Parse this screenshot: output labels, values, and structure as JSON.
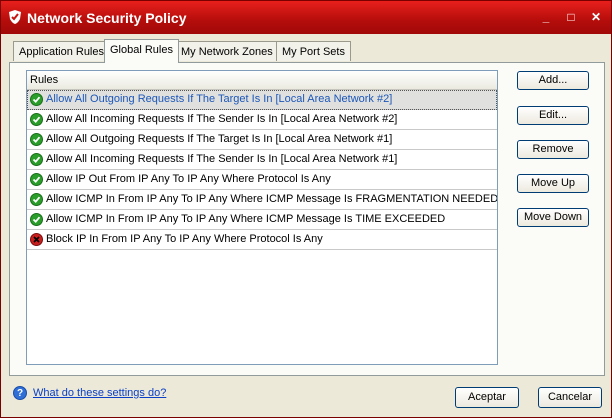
{
  "window": {
    "title": "Network Security Policy",
    "minimize_label": "_",
    "maximize_label": "□",
    "close_label": "✕"
  },
  "tabs": [
    {
      "label": "Application Rules"
    },
    {
      "label": "Global Rules"
    },
    {
      "label": "My Network Zones"
    },
    {
      "label": "My Port Sets"
    }
  ],
  "rules": {
    "header": "Rules",
    "items": [
      {
        "text": "Allow All Outgoing Requests If The Target Is In [Local Area Network #2]",
        "status": "allow"
      },
      {
        "text": "Allow All Incoming Requests If The Sender Is In [Local Area Network #2]",
        "status": "allow"
      },
      {
        "text": "Allow All Outgoing Requests If The Target Is In [Local Area Network #1]",
        "status": "allow"
      },
      {
        "text": "Allow All Incoming Requests If The Sender Is In [Local Area Network #1]",
        "status": "allow"
      },
      {
        "text": "Allow IP Out From IP Any To IP Any Where Protocol Is Any",
        "status": "allow"
      },
      {
        "text": "Allow ICMP In From IP Any To IP Any Where ICMP Message Is FRAGMENTATION NEEDED",
        "status": "allow"
      },
      {
        "text": "Allow ICMP In From IP Any To IP Any Where ICMP Message Is TIME EXCEEDED",
        "status": "allow"
      },
      {
        "text": "Block IP In From IP Any To IP Any Where Protocol Is Any",
        "status": "block"
      }
    ]
  },
  "buttons": {
    "add": "Add...",
    "edit": "Edit...",
    "remove": "Remove",
    "move_up": "Move Up",
    "move_down": "Move Down"
  },
  "footer": {
    "help_link": "What do these settings do?",
    "ok": "Aceptar",
    "cancel": "Cancelar"
  },
  "colors": {
    "titlebar": "#c8130f",
    "allow_icon": "#2a9d2a",
    "block_icon": "#c81e1e",
    "selected_text": "#1c57b8"
  }
}
